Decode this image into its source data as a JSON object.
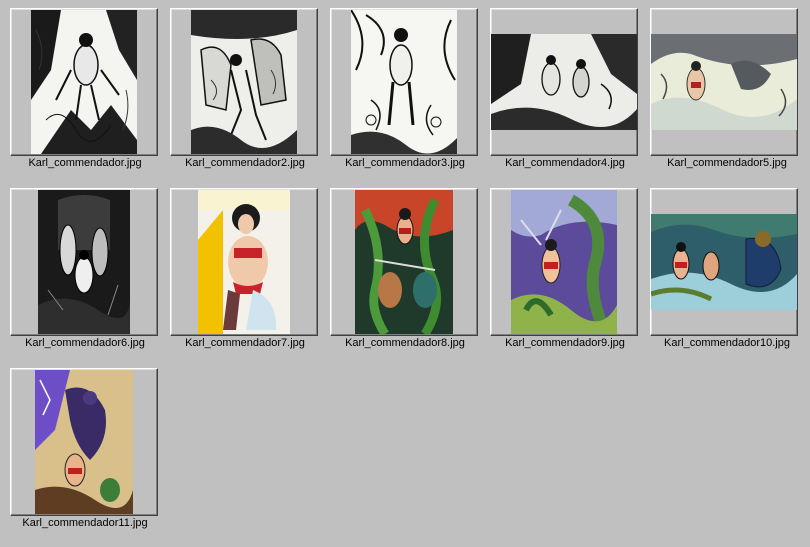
{
  "files": [
    {
      "name": "Karl_commendador.jpg",
      "style": "ink",
      "shape": "portrait"
    },
    {
      "name": "Karl_commendador2.jpg",
      "style": "ink",
      "shape": "portrait"
    },
    {
      "name": "Karl_commendador3.jpg",
      "style": "ink",
      "shape": "portrait"
    },
    {
      "name": "Karl_commendador4.jpg",
      "style": "ink",
      "shape": "landscape"
    },
    {
      "name": "Karl_commendador5.jpg",
      "style": "wash",
      "shape": "landscape"
    },
    {
      "name": "Karl_commendador6.jpg",
      "style": "ink-dark",
      "shape": "portrait"
    },
    {
      "name": "Karl_commendador7.jpg",
      "style": "pinup",
      "shape": "portrait"
    },
    {
      "name": "Karl_commendador8.jpg",
      "style": "color-green",
      "shape": "portrait"
    },
    {
      "name": "Karl_commendador9.jpg",
      "style": "color-purple",
      "shape": "portrait"
    },
    {
      "name": "Karl_commendador10.jpg",
      "style": "color-teal",
      "shape": "landscape"
    },
    {
      "name": "Karl_commendador11.jpg",
      "style": "color-violet",
      "shape": "portrait"
    }
  ],
  "colors": {
    "background": "#c0c0c0",
    "ink": "#111111",
    "paper": "#f4f4f0"
  }
}
